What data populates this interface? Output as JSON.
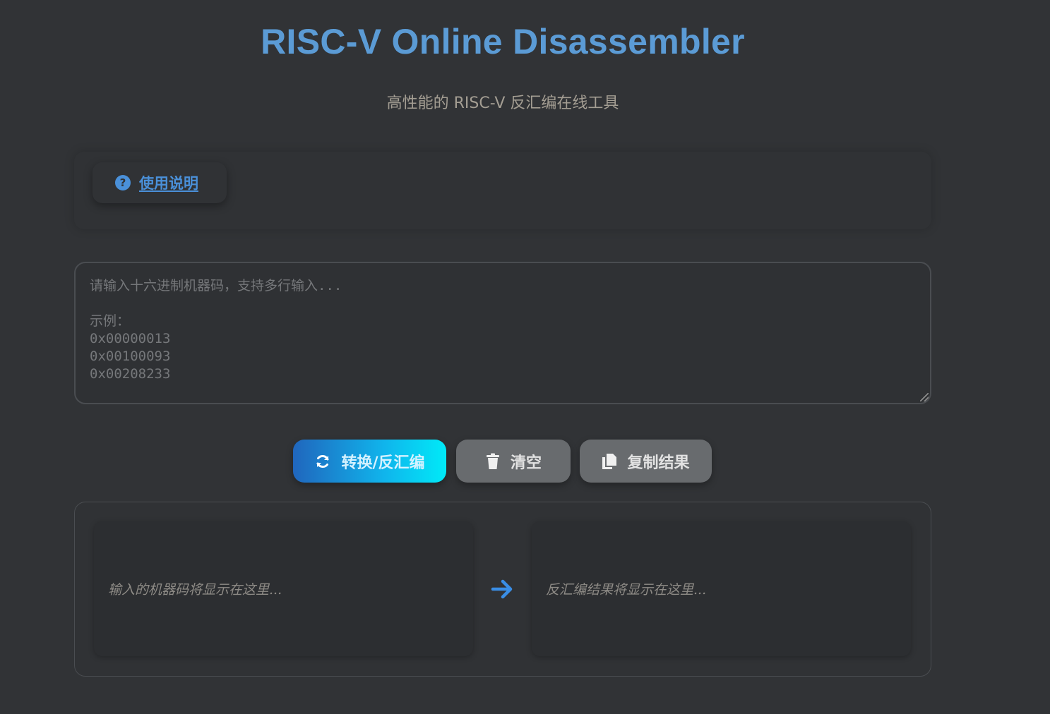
{
  "header": {
    "title": "RISC-V Online Disassembler",
    "subtitle": "高性能的 RISC-V 反汇编在线工具"
  },
  "help": {
    "label": "使用说明",
    "icon": "question-circle-icon"
  },
  "input": {
    "value": "",
    "placeholder": "请输入十六进制机器码，支持多行输入...\n\n示例：\n0x00000013\n0x00100093\n0x00208233"
  },
  "actions": {
    "convert_label": "转换/反汇编",
    "clear_label": "清空",
    "copy_label": "复制结果"
  },
  "results": {
    "input_placeholder": "输入的机器码将显示在这里...",
    "output_placeholder": "反汇编结果将显示在这里..."
  },
  "colors": {
    "background": "#313336",
    "accent": "#4a90d9",
    "title": "#5b9bd5",
    "convert_gradient_start": "#2066bd",
    "convert_gradient_end": "#00eaf8",
    "secondary_button": "#686b6e"
  }
}
